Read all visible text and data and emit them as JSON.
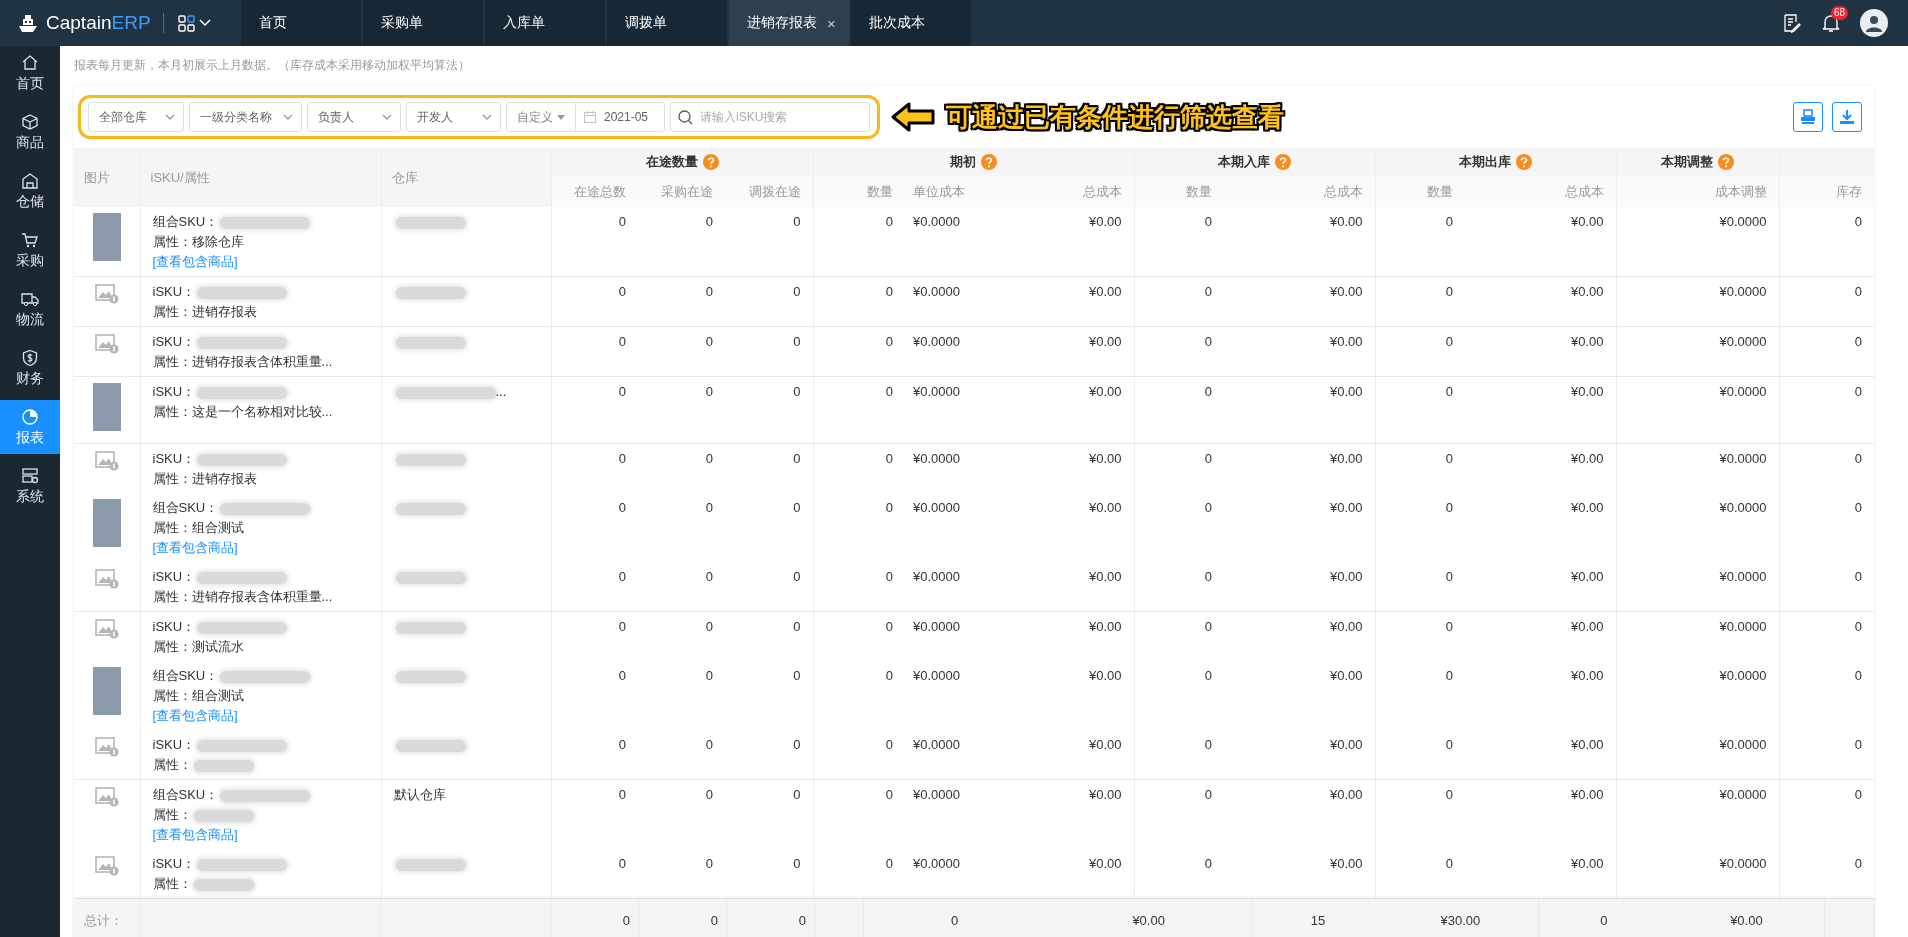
{
  "topbar": {
    "logo": {
      "brand": "Captain",
      "brand_accent": "ERP"
    },
    "tabs": [
      {
        "label": "首页",
        "selected": false
      },
      {
        "label": "采购单",
        "selected": false
      },
      {
        "label": "入库单",
        "selected": false
      },
      {
        "label": "调拨单",
        "selected": false
      },
      {
        "label": "进销存报表",
        "selected": true
      },
      {
        "label": "批次成本",
        "selected": false
      }
    ],
    "close_glyph": "×",
    "notification_count": "68"
  },
  "sidebar": {
    "items": [
      {
        "label": "首页",
        "selected": false
      },
      {
        "label": "商品",
        "selected": false
      },
      {
        "label": "仓储",
        "selected": false
      },
      {
        "label": "采购",
        "selected": false
      },
      {
        "label": "物流",
        "selected": false
      },
      {
        "label": "财务",
        "selected": false
      },
      {
        "label": "报表",
        "selected": true
      },
      {
        "label": "系统",
        "selected": false
      }
    ]
  },
  "note": "报表每月更新，本月初展示上月数据。（库存成本采用移动加权平均算法）",
  "filters": {
    "selects": [
      {
        "label": "全部仓库"
      },
      {
        "label": "一级分类名称"
      },
      {
        "label": "负责人"
      },
      {
        "label": "开发人"
      }
    ],
    "date": {
      "mode": "自定义",
      "value": "2021-05"
    },
    "search": {
      "placeholder": "请输入iSKU搜索"
    }
  },
  "annotation": {
    "text": "可通过已有条件进行筛选查看"
  },
  "table": {
    "columns": [
      {
        "label": "图片"
      },
      {
        "label": "iSKU/属性"
      },
      {
        "label": "仓库"
      }
    ],
    "column_groups": [
      {
        "label": "在途数量",
        "columns": [
          "在途总数",
          "采购在途",
          "调拨在途"
        ]
      },
      {
        "label": "期初",
        "columns": [
          "数量",
          "单位成本",
          "总成本"
        ]
      },
      {
        "label": "本期入库",
        "columns": [
          "数量",
          "总成本"
        ]
      },
      {
        "label": "本期出库",
        "columns": [
          "数量",
          "总成本"
        ]
      },
      {
        "label": "本期调整",
        "columns": [
          "成本调整"
        ]
      },
      {
        "columns": [
          "库存"
        ]
      }
    ],
    "row_groups": [
      {
        "items": [
          {
            "kind": "photo",
            "sku_label": "组合SKU：",
            "attribute_label": "属性：",
            "attribute": "移除仓库",
            "link": "[查看包含商品]",
            "warehouse_redacted": true,
            "values": [
              "0",
              "0",
              "0",
              "0",
              "¥0.0000",
              "¥0.00",
              "0",
              "¥0.00",
              "0",
              "¥0.00",
              "¥0.0000",
              "0"
            ]
          }
        ]
      },
      {
        "items": [
          {
            "kind": "placeholder",
            "sku_label": "iSKU：",
            "attribute_label": "属性：",
            "attribute": "进销存报表",
            "warehouse_redacted": true,
            "values": [
              "0",
              "0",
              "0",
              "0",
              "¥0.0000",
              "¥0.00",
              "0",
              "¥0.00",
              "0",
              "¥0.00",
              "¥0.0000",
              "0"
            ]
          }
        ]
      },
      {
        "items": [
          {
            "kind": "placeholder",
            "sku_label": "iSKU：",
            "attribute_label": "属性：",
            "attribute": "进销存报表含体积重量...",
            "warehouse_redacted": true,
            "values": [
              "0",
              "0",
              "0",
              "0",
              "¥0.0000",
              "¥0.00",
              "0",
              "¥0.00",
              "0",
              "¥0.00",
              "¥0.0000",
              "0"
            ]
          }
        ]
      },
      {
        "items": [
          {
            "kind": "photo",
            "sku_label": "iSKU：",
            "attribute_label": "属性：",
            "attribute": "这是一个名称相对比较...",
            "warehouse_redacted": true,
            "warehouse": "...",
            "values": [
              "0",
              "0",
              "0",
              "0",
              "¥0.0000",
              "¥0.00",
              "0",
              "¥0.00",
              "0",
              "¥0.00",
              "¥0.0000",
              "0"
            ]
          }
        ]
      },
      {
        "items": [
          {
            "kind": "placeholder",
            "sku_label": "iSKU：",
            "attribute_label": "属性：",
            "attribute": "进销存报表",
            "warehouse_redacted": true,
            "values": [
              "0",
              "0",
              "0",
              "0",
              "¥0.0000",
              "¥0.00",
              "0",
              "¥0.00",
              "0",
              "¥0.00",
              "¥0.0000",
              "0"
            ]
          },
          {
            "kind": "photo",
            "sku_label": "组合SKU：",
            "attribute_label": "属性：",
            "attribute": "组合测试",
            "link": "[查看包含商品]",
            "warehouse_redacted": true,
            "values": [
              "0",
              "0",
              "0",
              "0",
              "¥0.0000",
              "¥0.00",
              "0",
              "¥0.00",
              "0",
              "¥0.00",
              "¥0.0000",
              "0"
            ]
          },
          {
            "kind": "placeholder",
            "sku_label": "iSKU：",
            "attribute_label": "属性：",
            "attribute": "进销存报表含体积重量...",
            "warehouse_redacted": true,
            "values": [
              "0",
              "0",
              "0",
              "0",
              "¥0.0000",
              "¥0.00",
              "0",
              "¥0.00",
              "0",
              "¥0.00",
              "¥0.0000",
              "0"
            ]
          }
        ]
      },
      {
        "items": [
          {
            "kind": "placeholder",
            "sku_label": "iSKU：",
            "attribute_label": "属性：",
            "attribute": "测试流水",
            "warehouse_redacted": true,
            "values": [
              "0",
              "0",
              "0",
              "0",
              "¥0.0000",
              "¥0.00",
              "0",
              "¥0.00",
              "0",
              "¥0.00",
              "¥0.0000",
              "0"
            ]
          },
          {
            "kind": "photo",
            "sku_label": "组合SKU：",
            "attribute_label": "属性：",
            "attribute": "组合测试",
            "link": "[查看包含商品]",
            "warehouse_redacted": true,
            "values": [
              "0",
              "0",
              "0",
              "0",
              "¥0.0000",
              "¥0.00",
              "0",
              "¥0.00",
              "0",
              "¥0.00",
              "¥0.0000",
              "0"
            ]
          },
          {
            "kind": "placeholder",
            "sku_label": "iSKU：",
            "attribute_label": "属性：",
            "attribute_redacted": true,
            "warehouse_redacted": true,
            "values": [
              "0",
              "0",
              "0",
              "0",
              "¥0.0000",
              "¥0.00",
              "0",
              "¥0.00",
              "0",
              "¥0.00",
              "¥0.0000",
              "0"
            ]
          }
        ]
      },
      {
        "items": [
          {
            "kind": "placeholder",
            "sku_label": "组合SKU：",
            "attribute_label": "属性：",
            "attribute_redacted": true,
            "link": "[查看包含商品]",
            "warehouse": "默认仓库",
            "values": [
              "0",
              "0",
              "0",
              "0",
              "¥0.0000",
              "¥0.00",
              "0",
              "¥0.00",
              "0",
              "¥0.00",
              "¥0.0000",
              "0"
            ]
          },
          {
            "kind": "placeholder",
            "sku_label": "iSKU：",
            "attribute_label": "属性：",
            "attribute_redacted": true,
            "warehouse_redacted": true,
            "values": [
              "0",
              "0",
              "0",
              "0",
              "¥0.0000",
              "¥0.00",
              "0",
              "¥0.00",
              "0",
              "¥0.00",
              "¥0.0000",
              "0"
            ]
          }
        ]
      }
    ],
    "footer": {
      "label": "总计：",
      "cells": [
        "0",
        "0",
        "0",
        "0",
        "¥0.00",
        "15",
        "¥30.00",
        "0",
        "¥0.00"
      ]
    }
  }
}
